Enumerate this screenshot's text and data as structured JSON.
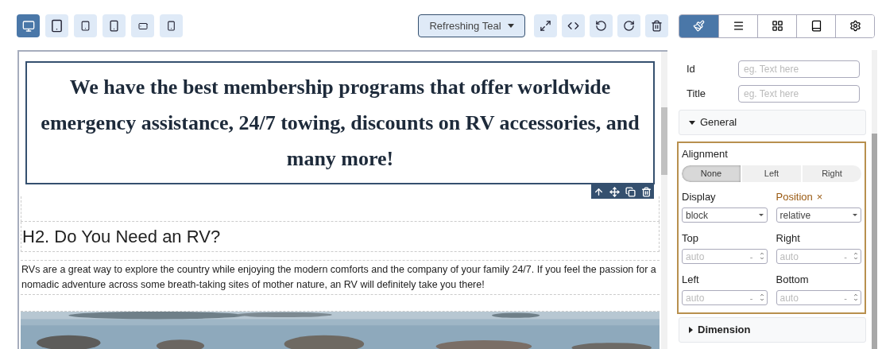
{
  "devices": [
    {
      "kind": "desktop",
      "selected": true
    },
    {
      "kind": "tablet",
      "selected": false
    },
    {
      "kind": "tablet-small",
      "selected": false
    },
    {
      "kind": "phone",
      "selected": false
    },
    {
      "kind": "phone-landscape",
      "selected": false
    },
    {
      "kind": "phone-small",
      "selected": false
    }
  ],
  "theme": {
    "label": "Refreshing Teal"
  },
  "actions": [
    {
      "kind": "fullscreen"
    },
    {
      "kind": "code"
    },
    {
      "kind": "undo"
    },
    {
      "kind": "redo"
    },
    {
      "kind": "delete"
    }
  ],
  "panel_tabs": [
    {
      "kind": "style",
      "selected": true
    },
    {
      "kind": "layers",
      "selected": false
    },
    {
      "kind": "blocks",
      "selected": false
    },
    {
      "kind": "book",
      "selected": false
    },
    {
      "kind": "settings",
      "selected": false
    }
  ],
  "canvas": {
    "heading": "We have the best membership programs that offer worldwide emergency assistance, 24/7 towing, discounts on RV accessories, and many more!",
    "selection_tools": [
      {
        "kind": "up"
      },
      {
        "kind": "move"
      },
      {
        "kind": "copy"
      },
      {
        "kind": "delete"
      }
    ],
    "subheading": "H2. Do You Need an RV?",
    "paragraph": "RVs are a great way to explore the country while enjoying the modern comforts and the company of your family 24/7. If you feel the passion for a nomadic adventure across some breath-taking sites of mother nature, an RV will definitely take you there!"
  },
  "attributes": [
    {
      "label": "Id",
      "placeholder": "eg. Text here"
    },
    {
      "label": "Title",
      "placeholder": "eg. Text here"
    }
  ],
  "sections": [
    {
      "title": "General",
      "expanded": true,
      "alignment": {
        "label": "Alignment",
        "options": [
          {
            "label": "None",
            "selected": true
          },
          {
            "label": "Left",
            "selected": false
          },
          {
            "label": "Right",
            "selected": false
          }
        ]
      },
      "selects": [
        {
          "label": "Display",
          "value": "block",
          "changed": false
        },
        {
          "label": "Position",
          "value": "relative",
          "changed": true,
          "clear": "×"
        }
      ],
      "offsets": [
        {
          "label": "Top",
          "placeholder": "auto",
          "unit": "-"
        },
        {
          "label": "Right",
          "placeholder": "auto",
          "unit": "-"
        },
        {
          "label": "Left",
          "placeholder": "auto",
          "unit": "-"
        },
        {
          "label": "Bottom",
          "placeholder": "auto",
          "unit": "-"
        }
      ]
    },
    {
      "title": "Dimension",
      "expanded": false
    }
  ]
}
